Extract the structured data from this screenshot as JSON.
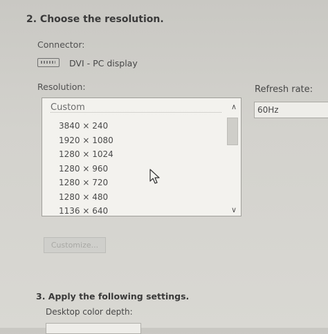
{
  "section2": {
    "heading": "2. Choose the resolution.",
    "connector_label": "Connector:",
    "connector_name": "DVI - PC display",
    "resolution_label": "Resolution:",
    "refresh_label": "Refresh rate:",
    "list_header": "Custom",
    "resolutions": [
      "3840 × 240",
      "1920 × 1080",
      "1280 × 1024",
      "1280 × 960",
      "1280 × 720",
      "1280 × 480",
      "1136 × 640"
    ],
    "refresh_value": "60Hz",
    "customize_label": "Customize..."
  },
  "section3": {
    "heading": "3. Apply the following settings.",
    "depth_label": "Desktop color depth:"
  },
  "icons": {
    "connector": "dvi-connector-icon",
    "scroll_up": "chevron-up-icon",
    "scroll_down": "chevron-down-icon",
    "cursor": "mouse-pointer-icon"
  }
}
